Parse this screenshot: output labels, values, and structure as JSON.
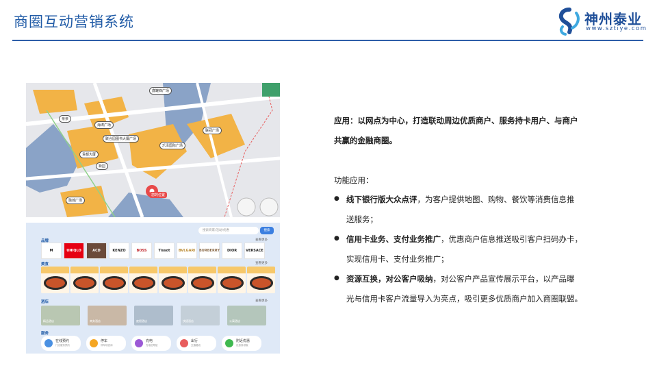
{
  "header": {
    "title": "商圈互动营销系统"
  },
  "logo": {
    "name": "神州泰业",
    "url": "www.sztiye.com",
    "colors": {
      "primary": "#1f4f99",
      "accent": "#3fa9e0"
    }
  },
  "map": {
    "pin_label": "您的位置",
    "tags": [
      "鑫罐西广场",
      "亲亲",
      "海涛广场",
      "联合园图书大厦广场",
      "贵都大厦",
      "乐泽国际广场",
      "联冠广场",
      "新园",
      "融城广场"
    ],
    "icons": [
      "pin-icon",
      "layers-icon",
      "zoom-in-icon",
      "zoom-out-icon"
    ]
  },
  "app": {
    "search_placeholder": "搜索商家/活动/优惠",
    "search_button": "搜索",
    "sections": {
      "brands": "品牌",
      "food": "美食",
      "stay": "酒店",
      "service": "服务"
    },
    "more": "查看更多",
    "brands": [
      "M",
      "UNIQLO",
      "ACD",
      "KENZO",
      "BOSS",
      "Tissot",
      "BVLGARI",
      "BURBERRY",
      "DIOR",
      "VERSACE"
    ],
    "food_count": 8,
    "rooms": [
      "精品酒店",
      "商务酒店",
      "度假酒店",
      "快捷酒店",
      "公寓酒店"
    ],
    "services": [
      {
        "label": "在线预约",
        "sub": "门店服务预约",
        "color": "#4a90e2"
      },
      {
        "label": "停车",
        "sub": "停车场查询",
        "color": "#f5a623"
      },
      {
        "label": "充电",
        "sub": "充电桩导航",
        "color": "#9b59d6"
      },
      {
        "label": "出行",
        "sub": "交通路线",
        "color": "#e85d5d"
      },
      {
        "label": "附近优惠",
        "sub": "优惠券领取",
        "color": "#3fb950"
      }
    ]
  },
  "content": {
    "intro_label": "应用：",
    "intro": "以网点为中心，打造联动周边优质商户、服务持卡用户、与商户",
    "intro2": "共赢的金融商圈。",
    "func_title": "功能应用：",
    "bullets": [
      {
        "bold": "线下银行版大众点评",
        "text": "，为客户提供地图、购物、餐饮等消费信息推",
        "cont": "送服务；"
      },
      {
        "bold": "信用卡业务、支付业务推广",
        "text": "，优惠商户信息推送吸引客户扫码办卡，",
        "cont": "实现信用卡、支付业务推广；"
      },
      {
        "bold": "资源互换，对公客户吸纳",
        "text": "，对公客户产品宣传展示平台，以产品曝",
        "cont": "光与信用卡客户流量导入为亮点，吸引更多优质商户加入商圈联盟。"
      }
    ]
  }
}
